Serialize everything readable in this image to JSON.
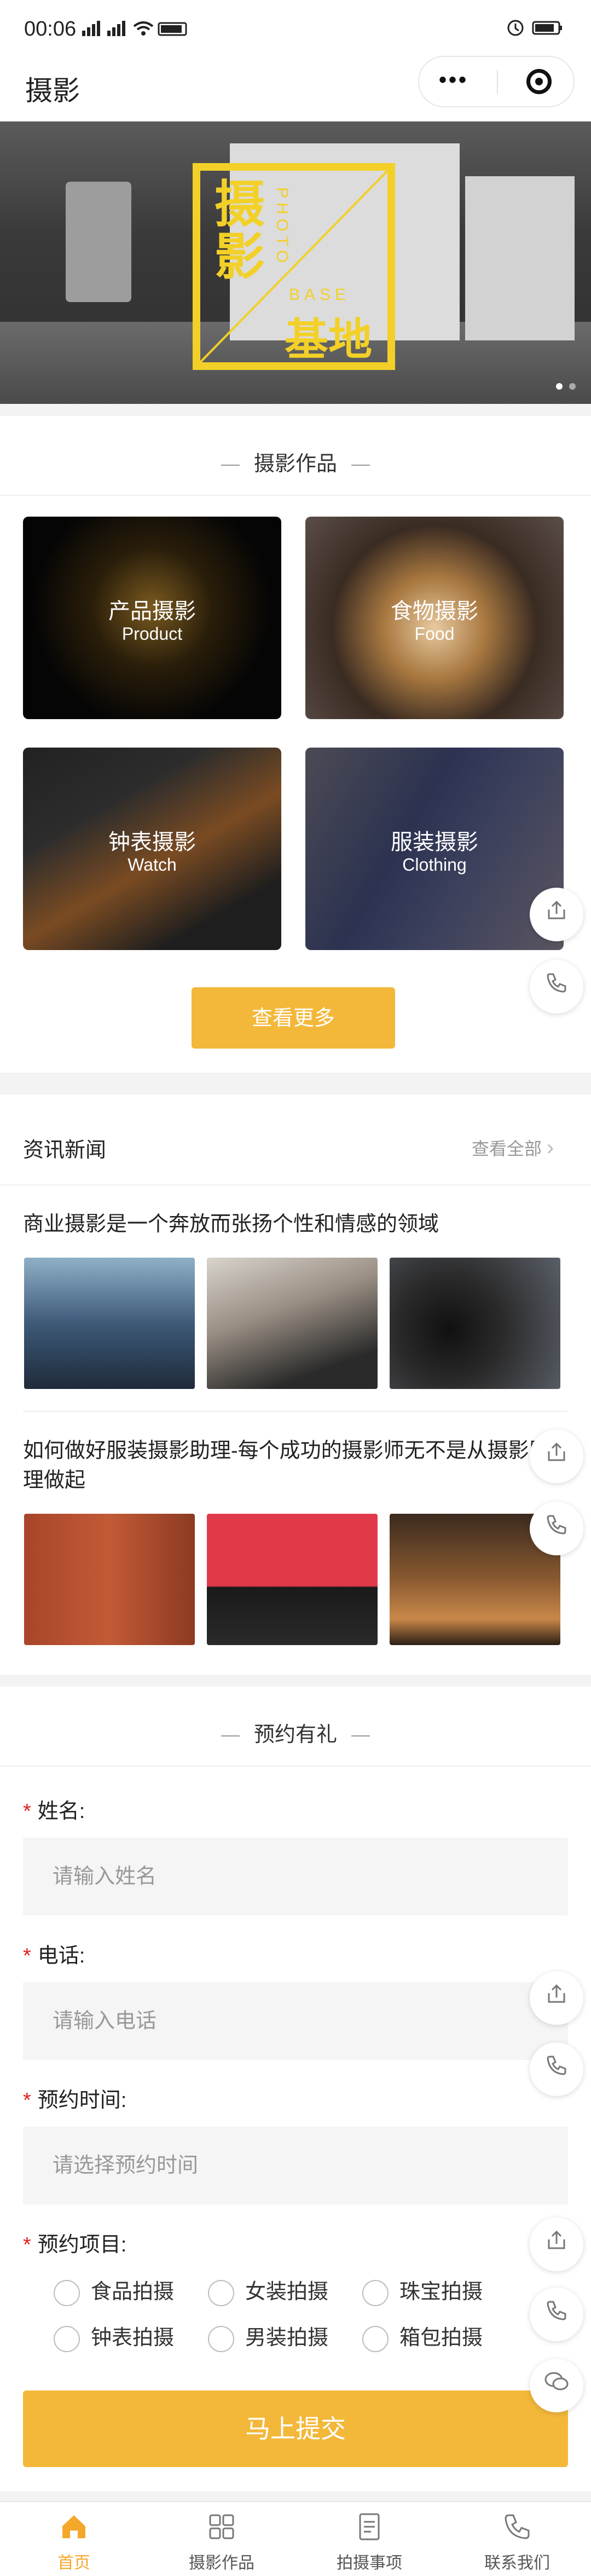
{
  "status": {
    "time": "00:06",
    "signal": "෽෽ ▲",
    "right_icons": "⏰ ▭"
  },
  "nav": {
    "title": "摄影"
  },
  "banner": {
    "title_top": "摄影",
    "title_bottom": "基地",
    "vertical_word": "PHOTO",
    "horizontal_word": "BASE",
    "page_dots": 2,
    "active_dot": 0
  },
  "works": {
    "heading": "摄影作品",
    "tiles": [
      {
        "title": "产品摄影",
        "subtitle": "Product"
      },
      {
        "title": "食物摄影",
        "subtitle": "Food"
      },
      {
        "title": "钟表摄影",
        "subtitle": "Watch"
      },
      {
        "title": "服装摄影",
        "subtitle": "Clothing"
      }
    ],
    "more_label": "查看更多"
  },
  "news": {
    "heading": "资讯新闻",
    "view_all": "查看全部",
    "items": [
      {
        "title": "商业摄影是一个奔放而张扬个性和情感的领域"
      },
      {
        "title": "如何做好服装摄影助理-每个成功的摄影师无不是从摄影助理做起"
      }
    ]
  },
  "booking": {
    "heading": "预约有礼",
    "fields": [
      {
        "label": "姓名:",
        "placeholder": "请输入姓名"
      },
      {
        "label": "电话:",
        "placeholder": "请输入电话"
      },
      {
        "label": "预约时间:",
        "placeholder": "请选择预约时间"
      }
    ],
    "items_label": "预约项目:",
    "options": [
      "食品拍摄",
      "女装拍摄",
      "珠宝拍摄",
      "钟表拍摄",
      "男装拍摄",
      "箱包拍摄"
    ],
    "submit_label": "马上提交"
  },
  "tabbar": {
    "tabs": [
      {
        "label": "首页",
        "active": true,
        "icon": "home-icon"
      },
      {
        "label": "摄影作品",
        "active": false,
        "icon": "grid-icon"
      },
      {
        "label": "拍摄事项",
        "active": false,
        "icon": "document-icon"
      },
      {
        "label": "联系我们",
        "active": false,
        "icon": "phone-icon"
      }
    ]
  },
  "colors": {
    "accent": "#f3b83a",
    "required": "#e02020",
    "active_tab": "#f3a82a"
  }
}
